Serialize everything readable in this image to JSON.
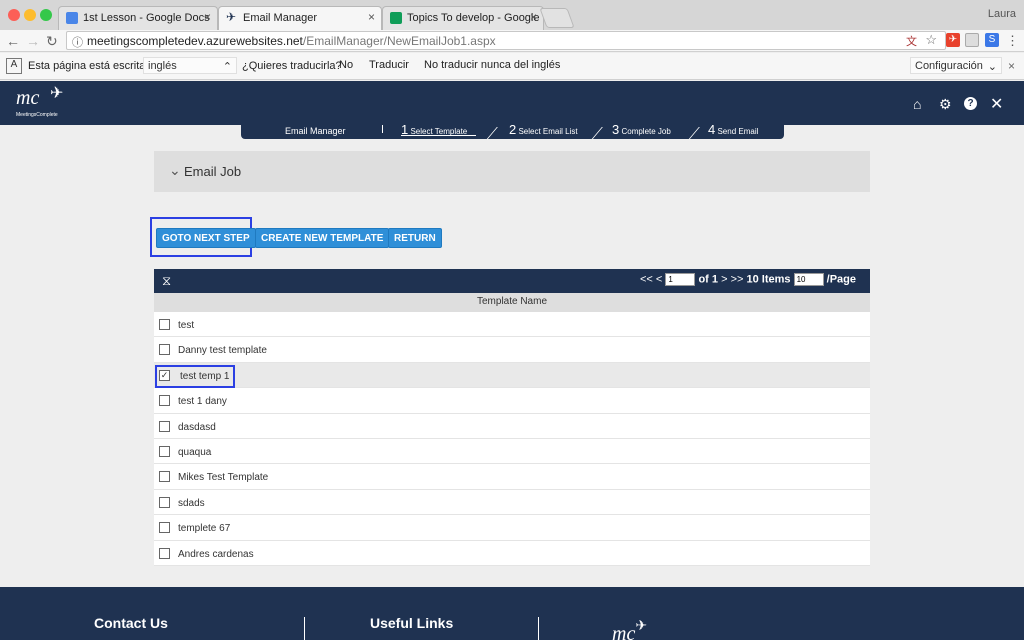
{
  "browser": {
    "tabs": [
      {
        "title": "1st Lesson - Google Docs",
        "color": "#4a86e8"
      },
      {
        "title": "Email Manager",
        "color": "#1f3251"
      },
      {
        "title": "Topics To develop - Google Sl",
        "color": "#0f9d58"
      }
    ],
    "profile": "Laura",
    "url_host": "meetingscompletedev.azurewebsites.net",
    "url_path": "/EmailManager/NewEmailJob1.aspx",
    "ext_s": "S"
  },
  "translate": {
    "prompt": "Esta página está escrita en",
    "language": "inglés",
    "question": "¿Quieres traducirla?",
    "no": "No",
    "translate": "Traducir",
    "never": "No traducir nunca del inglés",
    "settings": "Configuración"
  },
  "app": {
    "logo_text": "mc",
    "logo_sub": "MeetingsComplete"
  },
  "steps": {
    "section": "Email Manager",
    "items": [
      {
        "num": "1",
        "label": "Select Template"
      },
      {
        "num": "2",
        "label": "Select Email List"
      },
      {
        "num": "3",
        "label": "Complete Job"
      },
      {
        "num": "4",
        "label": "Send Email"
      }
    ]
  },
  "panel": {
    "title": "Email Job"
  },
  "actions": {
    "next": "GOTO NEXT STEP",
    "create": "CREATE NEW TEMPLATE",
    "return": "RETURN"
  },
  "pager": {
    "page": "1",
    "of": "of 1",
    "items": "10 Items",
    "per_page_value": "10",
    "per_page": "/Page"
  },
  "grid": {
    "column": "Template Name",
    "rows": [
      {
        "name": "test",
        "checked": false
      },
      {
        "name": "Danny test template",
        "checked": false
      },
      {
        "name": "test temp 1",
        "checked": true
      },
      {
        "name": "test 1 dany",
        "checked": false
      },
      {
        "name": "dasdasd",
        "checked": false
      },
      {
        "name": "quaqua",
        "checked": false
      },
      {
        "name": "Mikes Test Template",
        "checked": false
      },
      {
        "name": "sdads",
        "checked": false
      },
      {
        "name": "templete 67",
        "checked": false
      },
      {
        "name": "Andres cardenas",
        "checked": false
      }
    ]
  },
  "footer": {
    "contact": "Contact Us",
    "links": "Useful Links"
  }
}
